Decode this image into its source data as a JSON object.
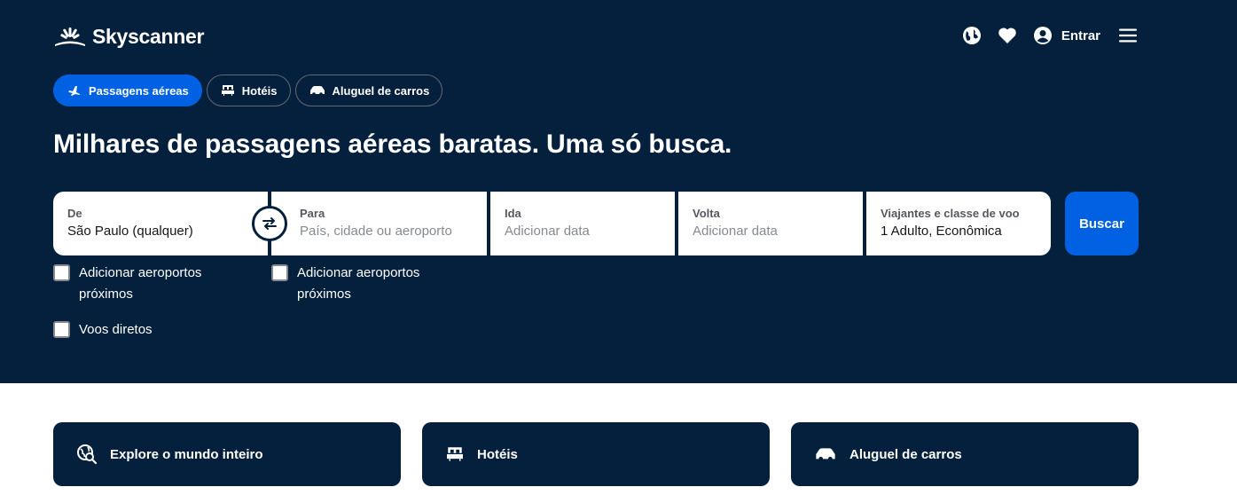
{
  "brand": {
    "name": "Skyscanner",
    "icon": "sun-logo-icon",
    "bg_color": "#05203c",
    "accent": "#0062e3"
  },
  "header": {
    "login_label": "Entrar",
    "icons": [
      "globe-icon",
      "heart-icon",
      "user-icon",
      "menu-icon"
    ]
  },
  "tabs": [
    {
      "label": "Passagens aéreas",
      "icon": "plane-icon",
      "active": true
    },
    {
      "label": "Hotéis",
      "icon": "bed-icon",
      "active": false
    },
    {
      "label": "Aluguel de carros",
      "icon": "car-icon",
      "active": false
    }
  ],
  "headline": "Milhares de passagens aéreas baratas. Uma só busca.",
  "search": {
    "from": {
      "label": "De",
      "value": "São Paulo (qualquer)"
    },
    "to": {
      "label": "Para",
      "placeholder": "País, cidade ou aeroporto"
    },
    "depart": {
      "label": "Ida",
      "placeholder": "Adicionar data"
    },
    "return": {
      "label": "Volta",
      "placeholder": "Adicionar data"
    },
    "travellers": {
      "label": "Viajantes e classe de voo",
      "value": "1 Adulto, Econômica"
    },
    "button": "Buscar"
  },
  "options": {
    "nearby_from": "Adicionar aeroportos próximos",
    "nearby_to": "Adicionar aeroportos próximos",
    "direct": "Voos diretos"
  },
  "cards": [
    {
      "label": "Explore o mundo inteiro",
      "icon": "explore-globe-icon"
    },
    {
      "label": "Hotéis",
      "icon": "bed-icon"
    },
    {
      "label": "Aluguel de carros",
      "icon": "car-icon"
    }
  ]
}
